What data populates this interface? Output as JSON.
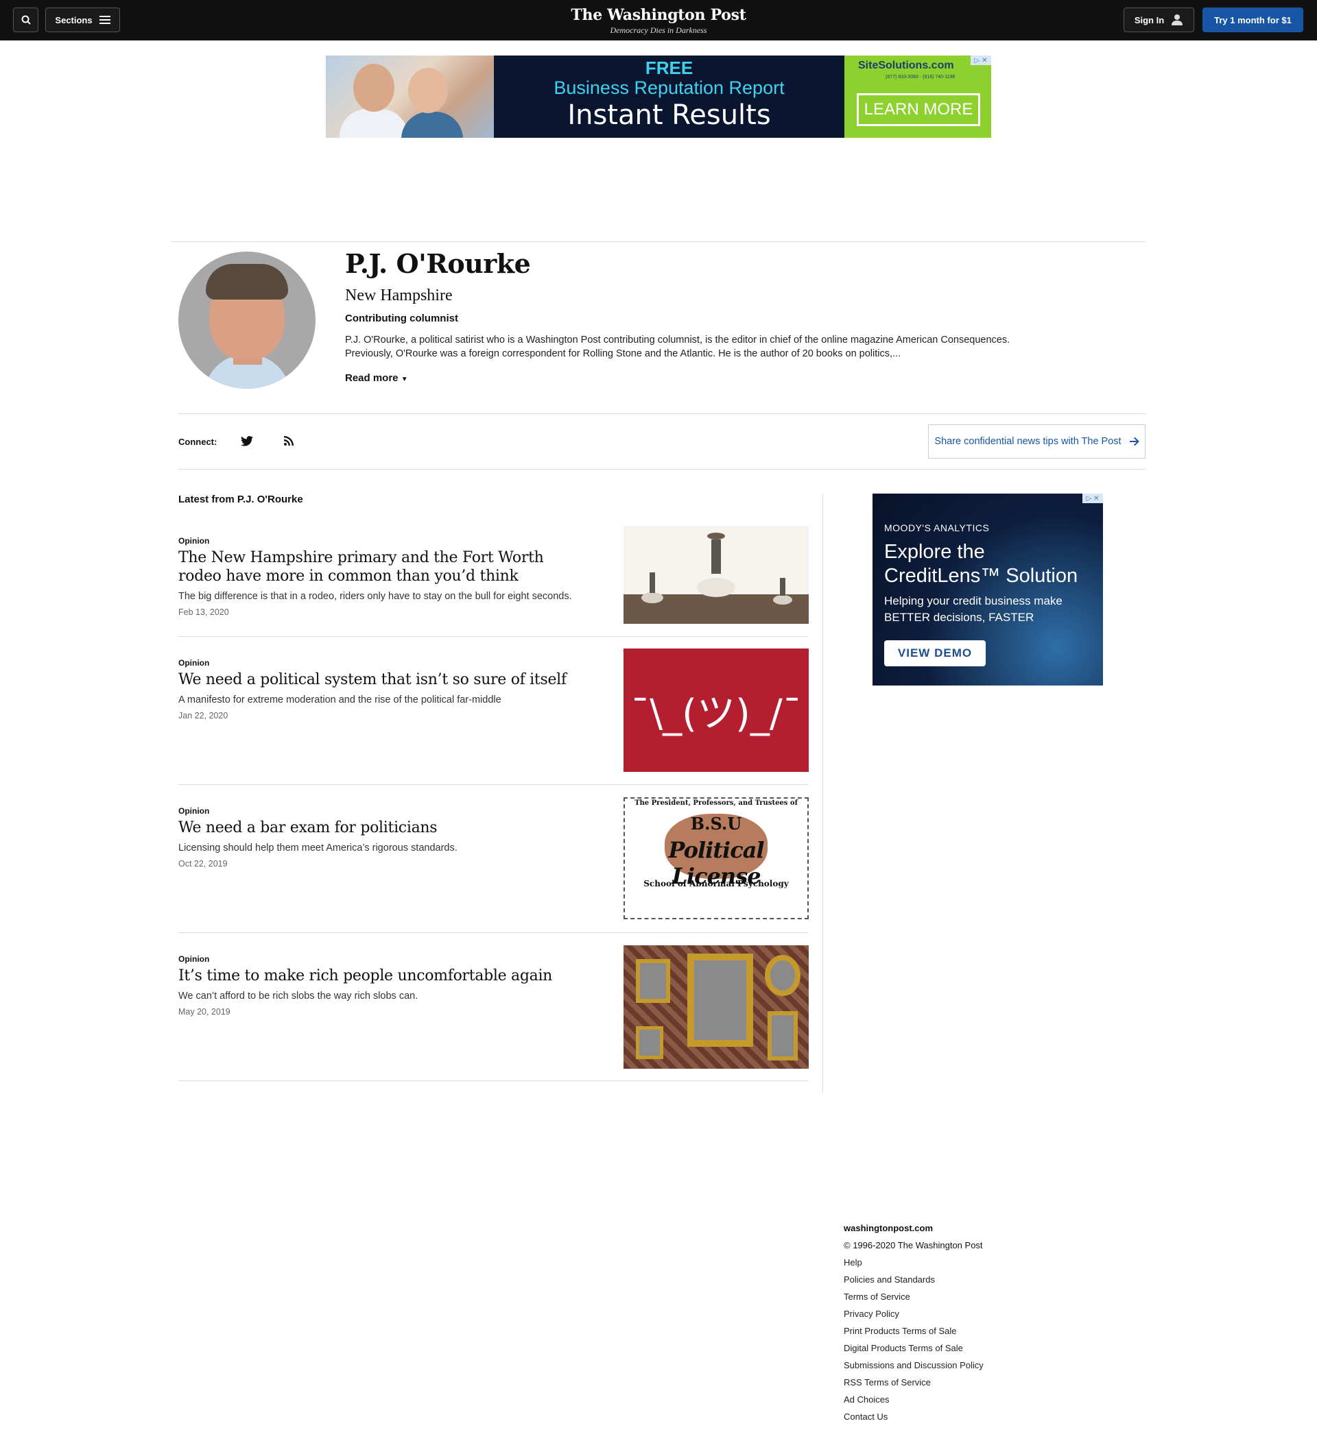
{
  "nav": {
    "sections_label": "Sections",
    "logo": "The Washington Post",
    "tagline": "Democracy Dies in Darkness",
    "signin_label": "Sign In",
    "subscribe_label": "Try 1 month for $1"
  },
  "banner_ad": {
    "line1": "FREE",
    "line2": "Business Reputation Report",
    "line3": "Instant Results",
    "brand": "SiteSolutions.com",
    "phone": "(877) 833-3083 · (916) 740-1198",
    "cta": "LEARN MORE"
  },
  "author": {
    "name": "P.J. O'Rourke",
    "location": "New Hampshire",
    "role": "Contributing columnist",
    "bio": "P.J. O'Rourke, a political satirist who is a Washington Post contributing columnist, is the editor in chief of the online magazine American Consequences. Previously, O'Rourke was a foreign correspondent for Rolling Stone and the Atlantic. He is the author of 20 books on politics,...",
    "read_more": "Read more"
  },
  "connect": {
    "label": "Connect:",
    "icons": [
      "twitter-icon",
      "rss-icon"
    ],
    "tips_label": "Share confidential news tips with The Post"
  },
  "latest": {
    "title": "Latest from P.J. O'Rourke",
    "articles": [
      {
        "kicker": "Opinion",
        "headline": "The New Hampshire primary and the Fort Worth rodeo have more in common than you’d think",
        "blurb": "The big difference is that in a rodeo, riders only have to stay on the bull for eight seconds.",
        "date": "Feb 13, 2020"
      },
      {
        "kicker": "Opinion",
        "headline": "We need a political system that isn’t so sure of itself",
        "blurb": "A manifesto for extreme moderation and the rise of the political far-middle",
        "date": "Jan 22, 2020",
        "image_text": "¯\\_(ツ)_/¯"
      },
      {
        "kicker": "Opinion",
        "headline": "We need a bar exam for politicians",
        "blurb": "Licensing should help them meet America’s rigorous standards.",
        "date": "Oct 22, 2019",
        "image_title": "The President, Professors, and Trustees of",
        "image_mid": "B.S.U",
        "image_main": "Political License",
        "image_sub": "School of Abnormal Psychology"
      },
      {
        "kicker": "Opinion",
        "headline": "It’s time to make rich people uncomfortable again",
        "blurb": "We can’t afford to be rich slobs the way rich slobs can.",
        "date": "May 20, 2019"
      }
    ]
  },
  "side_ad": {
    "brand": "MOODY'S ANALYTICS",
    "headline": "Explore the CreditLens™ Solution",
    "sub": "Helping your credit business make BETTER decisions, FASTER",
    "cta": "VIEW DEMO"
  },
  "footer": {
    "site": "washingtonpost.com",
    "copyright": "© 1996-2020 The Washington Post",
    "links": [
      "Help",
      "Policies and Standards",
      "Terms of Service",
      "Privacy Policy",
      "Print Products Terms of Sale",
      "Digital Products Terms of Sale",
      "Submissions and Discussion Policy",
      "RSS Terms of Service",
      "Ad Choices",
      "Contact Us"
    ]
  },
  "colors": {
    "nav_bg": "#111111",
    "accent": "#1955a5",
    "shrug_bg": "#b31f2f"
  }
}
